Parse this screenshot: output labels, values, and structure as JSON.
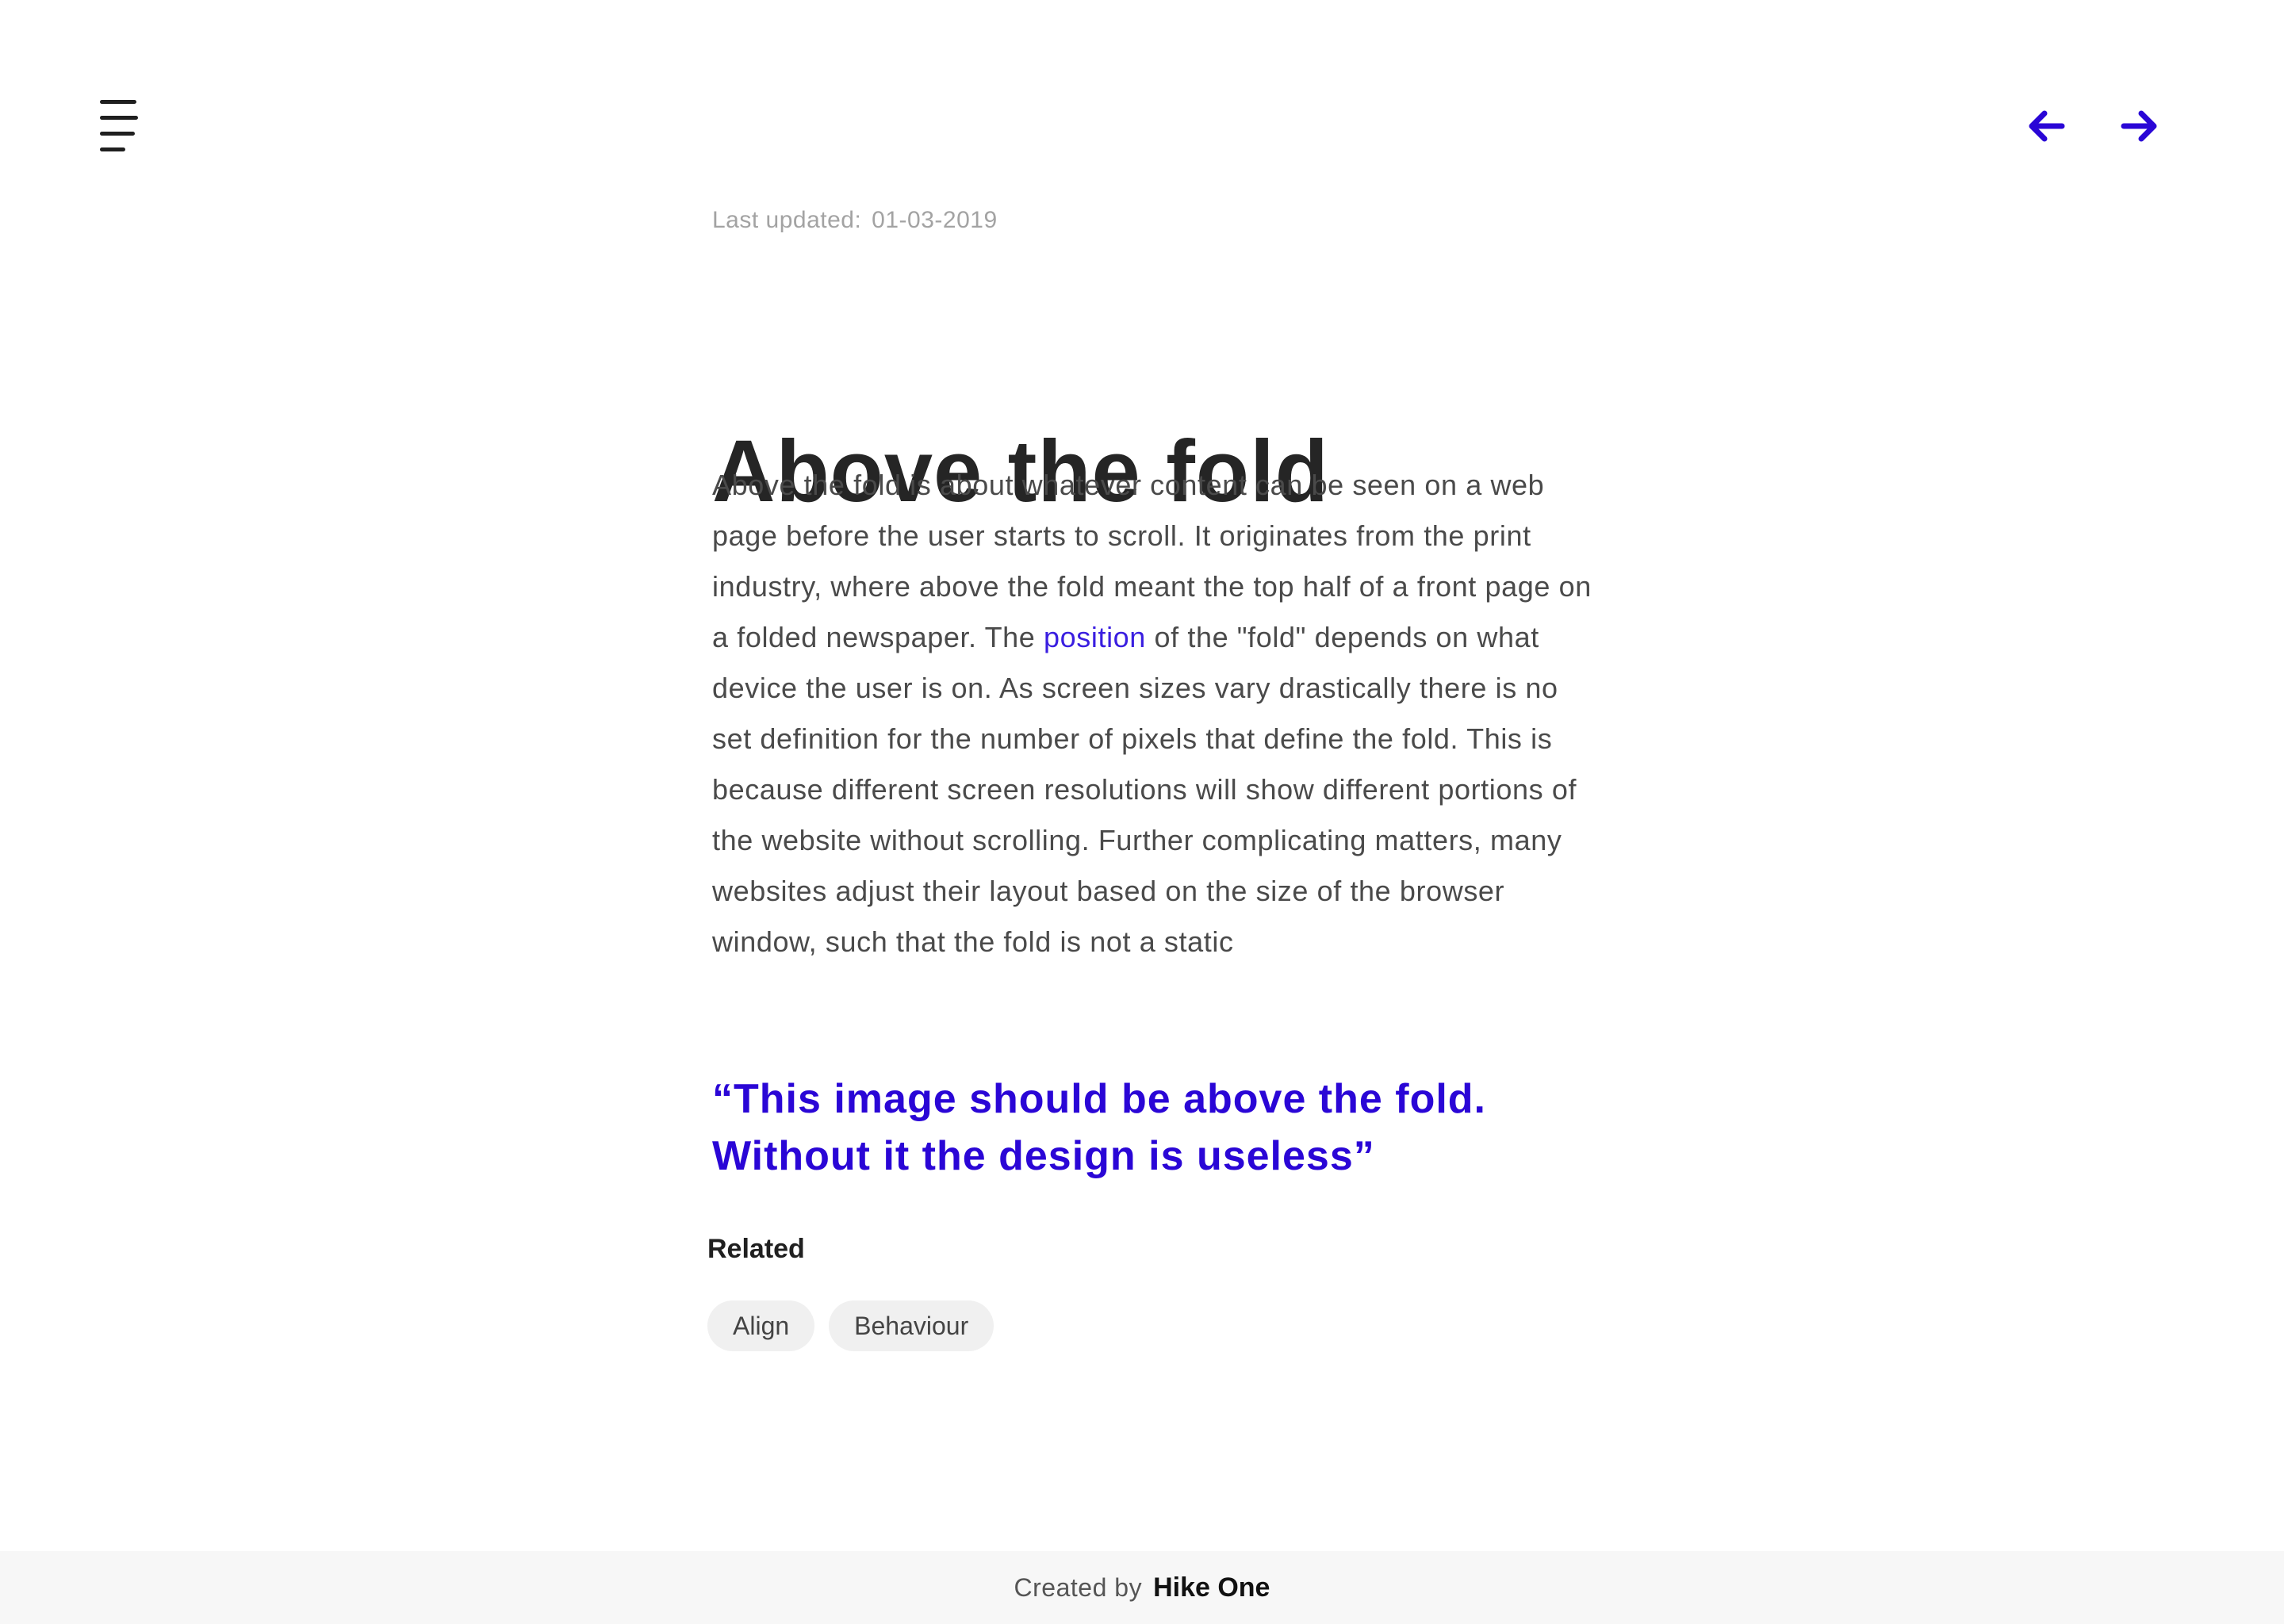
{
  "header": {
    "menu_icon": "hamburger-menu-icon",
    "prev_icon": "arrow-left-icon",
    "next_icon": "arrow-right-icon",
    "accent_color": "#2a06d6"
  },
  "article": {
    "last_updated_label": "Last updated:",
    "last_updated_date": "01-03-2019",
    "title": "Above the fold",
    "body_before_link": "Above the fold is about whatever content can be seen on a web page before the user starts to scroll. It originates from the print industry, where above the fold meant the top half of a front page on a folded newspaper. The ",
    "body_link": "position",
    "body_after_link": " of the \"fold\" depends on what device the user is on. As screen sizes vary drastically there is no set definition for the number of pixels that define the fold. This is because different screen resolutions will show different portions of the website without scrolling. Further complicating matters, many websites adjust their layout based on the size of the browser window, such that the fold is not a static",
    "quote": "“This image should be above the fold. Without it the design is useless”"
  },
  "related": {
    "heading": "Related",
    "tags": [
      "Align",
      "Behaviour"
    ]
  },
  "footer": {
    "created_by": "Created by",
    "brand": "Hike One"
  }
}
